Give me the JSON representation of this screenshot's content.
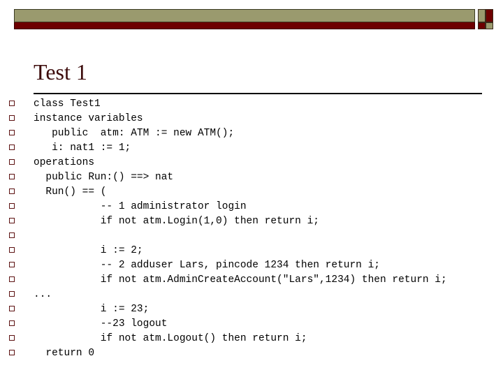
{
  "slide": {
    "title": "Test 1",
    "header": {
      "band_olive_color": "#9a9a6e",
      "band_maroon_color": "#6d0000",
      "checker_tl_color": "#9a9a6e",
      "checker_tr_color": "#6d0000",
      "checker_bl_color": "#6d0000",
      "checker_br_color": "#9a9a6e"
    },
    "title_color": "#3d0c0c",
    "bullet_color": "#5c1111",
    "body_lines": [
      {
        "text": "class Test1"
      },
      {
        "text": "instance variables"
      },
      {
        "text": "   public  atm: ATM := new ATM();"
      },
      {
        "text": "   i: nat1 := 1;"
      },
      {
        "text": "operations"
      },
      {
        "text": "  public Run:() ==> nat"
      },
      {
        "text": "  Run() == ("
      },
      {
        "text": "           -- 1 administrator login"
      },
      {
        "text": "           if not atm.Login(1,0) then return i;"
      },
      {
        "text": ""
      },
      {
        "text": "           i := 2;"
      },
      {
        "text": "           -- 2 adduser Lars, pincode 1234 then return i;"
      },
      {
        "text": "           if not atm.AdminCreateAccount(\"Lars\",1234) then return i;"
      },
      {
        "text": "..."
      },
      {
        "text": "           i := 23;"
      },
      {
        "text": "           --23 logout"
      },
      {
        "text": "           if not atm.Logout() then return i;"
      },
      {
        "text": "  return 0"
      }
    ]
  }
}
